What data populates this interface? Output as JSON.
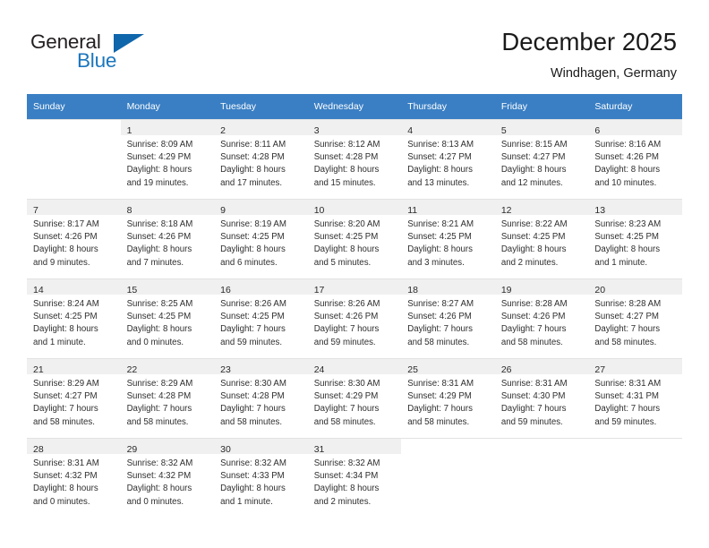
{
  "brand": {
    "name_part1": "General",
    "name_part2": "Blue",
    "accent_color": "#1b76bd",
    "triangle_color": "#0f66ab"
  },
  "header": {
    "title": "December 2025",
    "subtitle": "Windhagen, Germany"
  },
  "calendar": {
    "header_background": "#3a7fc4",
    "daynum_background": "#f0f0f0",
    "weekdays": [
      "Sunday",
      "Monday",
      "Tuesday",
      "Wednesday",
      "Thursday",
      "Friday",
      "Saturday"
    ],
    "weeks": [
      [
        {
          "day": "",
          "lines": []
        },
        {
          "day": "1",
          "lines": [
            "Sunrise: 8:09 AM",
            "Sunset: 4:29 PM",
            "Daylight: 8 hours",
            "and 19 minutes."
          ]
        },
        {
          "day": "2",
          "lines": [
            "Sunrise: 8:11 AM",
            "Sunset: 4:28 PM",
            "Daylight: 8 hours",
            "and 17 minutes."
          ]
        },
        {
          "day": "3",
          "lines": [
            "Sunrise: 8:12 AM",
            "Sunset: 4:28 PM",
            "Daylight: 8 hours",
            "and 15 minutes."
          ]
        },
        {
          "day": "4",
          "lines": [
            "Sunrise: 8:13 AM",
            "Sunset: 4:27 PM",
            "Daylight: 8 hours",
            "and 13 minutes."
          ]
        },
        {
          "day": "5",
          "lines": [
            "Sunrise: 8:15 AM",
            "Sunset: 4:27 PM",
            "Daylight: 8 hours",
            "and 12 minutes."
          ]
        },
        {
          "day": "6",
          "lines": [
            "Sunrise: 8:16 AM",
            "Sunset: 4:26 PM",
            "Daylight: 8 hours",
            "and 10 minutes."
          ]
        }
      ],
      [
        {
          "day": "7",
          "lines": [
            "Sunrise: 8:17 AM",
            "Sunset: 4:26 PM",
            "Daylight: 8 hours",
            "and 9 minutes."
          ]
        },
        {
          "day": "8",
          "lines": [
            "Sunrise: 8:18 AM",
            "Sunset: 4:26 PM",
            "Daylight: 8 hours",
            "and 7 minutes."
          ]
        },
        {
          "day": "9",
          "lines": [
            "Sunrise: 8:19 AM",
            "Sunset: 4:25 PM",
            "Daylight: 8 hours",
            "and 6 minutes."
          ]
        },
        {
          "day": "10",
          "lines": [
            "Sunrise: 8:20 AM",
            "Sunset: 4:25 PM",
            "Daylight: 8 hours",
            "and 5 minutes."
          ]
        },
        {
          "day": "11",
          "lines": [
            "Sunrise: 8:21 AM",
            "Sunset: 4:25 PM",
            "Daylight: 8 hours",
            "and 3 minutes."
          ]
        },
        {
          "day": "12",
          "lines": [
            "Sunrise: 8:22 AM",
            "Sunset: 4:25 PM",
            "Daylight: 8 hours",
            "and 2 minutes."
          ]
        },
        {
          "day": "13",
          "lines": [
            "Sunrise: 8:23 AM",
            "Sunset: 4:25 PM",
            "Daylight: 8 hours",
            "and 1 minute."
          ]
        }
      ],
      [
        {
          "day": "14",
          "lines": [
            "Sunrise: 8:24 AM",
            "Sunset: 4:25 PM",
            "Daylight: 8 hours",
            "and 1 minute."
          ]
        },
        {
          "day": "15",
          "lines": [
            "Sunrise: 8:25 AM",
            "Sunset: 4:25 PM",
            "Daylight: 8 hours",
            "and 0 minutes."
          ]
        },
        {
          "day": "16",
          "lines": [
            "Sunrise: 8:26 AM",
            "Sunset: 4:25 PM",
            "Daylight: 7 hours",
            "and 59 minutes."
          ]
        },
        {
          "day": "17",
          "lines": [
            "Sunrise: 8:26 AM",
            "Sunset: 4:26 PM",
            "Daylight: 7 hours",
            "and 59 minutes."
          ]
        },
        {
          "day": "18",
          "lines": [
            "Sunrise: 8:27 AM",
            "Sunset: 4:26 PM",
            "Daylight: 7 hours",
            "and 58 minutes."
          ]
        },
        {
          "day": "19",
          "lines": [
            "Sunrise: 8:28 AM",
            "Sunset: 4:26 PM",
            "Daylight: 7 hours",
            "and 58 minutes."
          ]
        },
        {
          "day": "20",
          "lines": [
            "Sunrise: 8:28 AM",
            "Sunset: 4:27 PM",
            "Daylight: 7 hours",
            "and 58 minutes."
          ]
        }
      ],
      [
        {
          "day": "21",
          "lines": [
            "Sunrise: 8:29 AM",
            "Sunset: 4:27 PM",
            "Daylight: 7 hours",
            "and 58 minutes."
          ]
        },
        {
          "day": "22",
          "lines": [
            "Sunrise: 8:29 AM",
            "Sunset: 4:28 PM",
            "Daylight: 7 hours",
            "and 58 minutes."
          ]
        },
        {
          "day": "23",
          "lines": [
            "Sunrise: 8:30 AM",
            "Sunset: 4:28 PM",
            "Daylight: 7 hours",
            "and 58 minutes."
          ]
        },
        {
          "day": "24",
          "lines": [
            "Sunrise: 8:30 AM",
            "Sunset: 4:29 PM",
            "Daylight: 7 hours",
            "and 58 minutes."
          ]
        },
        {
          "day": "25",
          "lines": [
            "Sunrise: 8:31 AM",
            "Sunset: 4:29 PM",
            "Daylight: 7 hours",
            "and 58 minutes."
          ]
        },
        {
          "day": "26",
          "lines": [
            "Sunrise: 8:31 AM",
            "Sunset: 4:30 PM",
            "Daylight: 7 hours",
            "and 59 minutes."
          ]
        },
        {
          "day": "27",
          "lines": [
            "Sunrise: 8:31 AM",
            "Sunset: 4:31 PM",
            "Daylight: 7 hours",
            "and 59 minutes."
          ]
        }
      ],
      [
        {
          "day": "28",
          "lines": [
            "Sunrise: 8:31 AM",
            "Sunset: 4:32 PM",
            "Daylight: 8 hours",
            "and 0 minutes."
          ]
        },
        {
          "day": "29",
          "lines": [
            "Sunrise: 8:32 AM",
            "Sunset: 4:32 PM",
            "Daylight: 8 hours",
            "and 0 minutes."
          ]
        },
        {
          "day": "30",
          "lines": [
            "Sunrise: 8:32 AM",
            "Sunset: 4:33 PM",
            "Daylight: 8 hours",
            "and 1 minute."
          ]
        },
        {
          "day": "31",
          "lines": [
            "Sunrise: 8:32 AM",
            "Sunset: 4:34 PM",
            "Daylight: 8 hours",
            "and 2 minutes."
          ]
        },
        {
          "day": "",
          "lines": []
        },
        {
          "day": "",
          "lines": []
        },
        {
          "day": "",
          "lines": []
        }
      ]
    ]
  }
}
